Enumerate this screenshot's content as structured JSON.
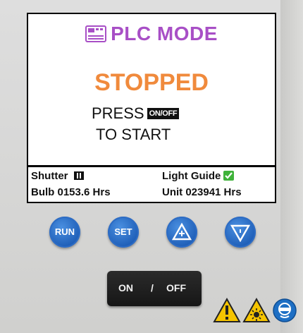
{
  "display": {
    "mode_title": "PLC MODE",
    "status": "STOPPED",
    "press_text": "PRESS",
    "onoff_chip": "ON/OFF",
    "start_text": "TO START"
  },
  "info": {
    "shutter_label": "Shutter",
    "light_guide_label": "Light Guide",
    "bulb_hours": "Bulb 0153.6 Hrs",
    "unit_hours": "Unit 023941 Hrs"
  },
  "buttons": {
    "run_label": "RUN",
    "set_label": "SET",
    "on_label": "ON",
    "separator": "/",
    "off_label": "OFF"
  },
  "colors": {
    "mode_title": "#a84fc6",
    "status": "#f08a3c",
    "button_blue": "#1f5fb8",
    "check_green": "#3fb23a",
    "warning_yellow": "#f5c400"
  },
  "icons": {
    "mode": "plc-module-icon",
    "shutter": "shutter-closed-icon",
    "light_guide": "checkmark-icon",
    "up": "up-triangle-plus-icon",
    "down": "down-triangle-minus-icon",
    "warning": "warning-triangle-icon",
    "radiation": "bright-light-warning-icon",
    "eye_protection": "eye-protection-icon"
  }
}
